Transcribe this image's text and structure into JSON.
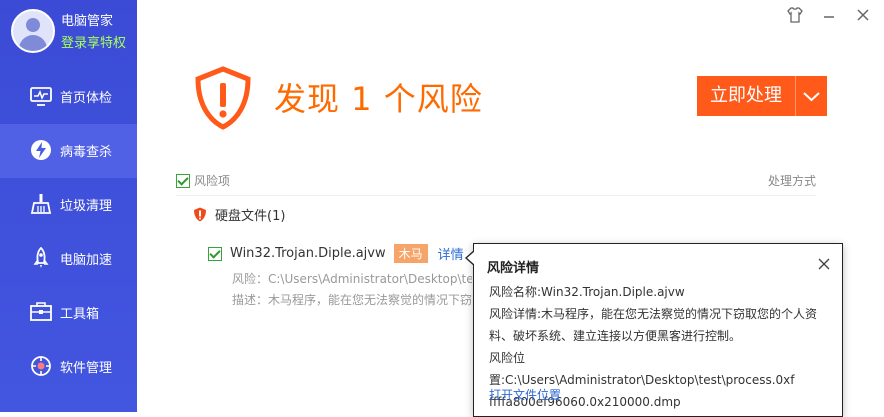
{
  "app": {
    "name": "电脑管家",
    "login_link": "登录享特权"
  },
  "sidebar": {
    "items": [
      {
        "label": "首页体检",
        "icon": "monitor-icon"
      },
      {
        "label": "病毒查杀",
        "icon": "lightning-icon",
        "active": true
      },
      {
        "label": "垃圾清理",
        "icon": "broom-icon"
      },
      {
        "label": "电脑加速",
        "icon": "rocket-icon"
      },
      {
        "label": "工具箱",
        "icon": "toolbox-icon"
      },
      {
        "label": "软件管理",
        "icon": "app-manager-icon"
      }
    ]
  },
  "titlebar": {
    "icons": [
      "skin-icon",
      "minimize-icon",
      "close-icon"
    ]
  },
  "main": {
    "headline": "发现 1 个风险",
    "action_label": "立即处理",
    "list_header": {
      "risk_items": "风险项",
      "handling": "处理方式"
    },
    "group": {
      "label": "硬盘文件(1)"
    },
    "item": {
      "name": "Win32.Trojan.Diple.ajvw",
      "tag": "木马",
      "detail_link": "详情",
      "risk_line": "风险：C:\\Users\\Administrator\\Desktop\\test\\",
      "desc_line": "描述：木马程序，能在您无法察觉的情况下窃取"
    }
  },
  "popover": {
    "title": "风险详情",
    "lines": [
      "风险名称:Win32.Trojan.Diple.ajvw",
      "风险详情:木马程序，能在您无法察觉的情况下窃取您的个人资",
      "料、破坏系统、建立连接以方便黑客进行控制。",
      "风险位置:C:\\Users\\Administrator\\Desktop\\test\\process.0xf",
      "ffffa800ef96060.0x210000.dmp"
    ],
    "open_location": "打开文件位置"
  },
  "colors": {
    "accent": "#ff5a1a",
    "sidebar": "#3f50dc",
    "link": "#2d6ad6"
  }
}
